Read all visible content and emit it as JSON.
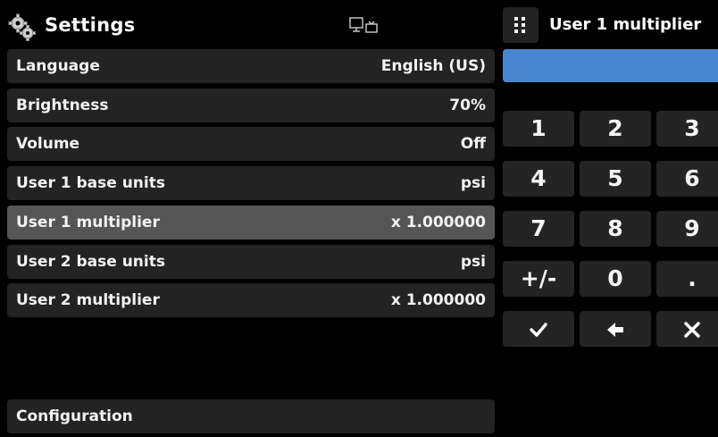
{
  "header": {
    "title": "Settings",
    "icon": "gear-icon",
    "remote_icon": "remote-display-icon"
  },
  "settings": {
    "rows": [
      {
        "label": "Language",
        "value": "English (US)"
      },
      {
        "label": "Brightness",
        "value": "70%"
      },
      {
        "label": "Volume",
        "value": "Off"
      },
      {
        "label": "User 1 base units",
        "value": "psi"
      },
      {
        "label": "User 1 multiplier",
        "value": "x 1.000000",
        "selected": true
      },
      {
        "label": "User 2 base units",
        "value": "psi"
      },
      {
        "label": "User 2 multiplier",
        "value": "x 1.000000"
      }
    ],
    "configuration_label": "Configuration"
  },
  "keypad": {
    "title": "User 1 multiplier",
    "menu_icon": "grid-icon",
    "entry_value": "",
    "entry_color": "#4a86cf",
    "keys": [
      "1",
      "2",
      "3",
      "4",
      "5",
      "6",
      "7",
      "8",
      "9",
      "+/-",
      "0",
      ".",
      "✓",
      "🡐",
      "✕"
    ],
    "key_icons": {
      "✓": "check-icon",
      "🡐": "backspace-icon",
      "✕": "close-icon"
    }
  }
}
